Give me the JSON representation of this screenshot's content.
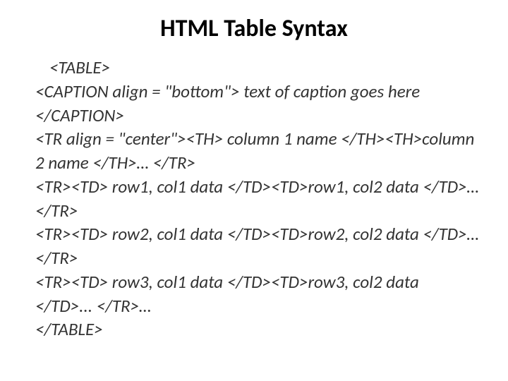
{
  "title": "HTML Table Syntax",
  "code": {
    "line1": "<TABLE>",
    "line2": "<CAPTION align = \"bottom\"> text of caption goes here </CAPTION>",
    "line3": "<TR align = \"center\"><TH> column 1 name </TH><TH>column 2 name </TH>… </TR>",
    "line4": "<TR><TD> row1, col1 data </TD><TD>row1, col2 data </TD>… </TR>",
    "line5": "<TR><TD> row2, col1 data </TD><TD>row2, col2 data </TD>… </TR>",
    "line6": "<TR><TD> row3, col1 data </TD><TD>row3, col2 data </TD>... </TR>…",
    "line7": "</TABLE>"
  }
}
